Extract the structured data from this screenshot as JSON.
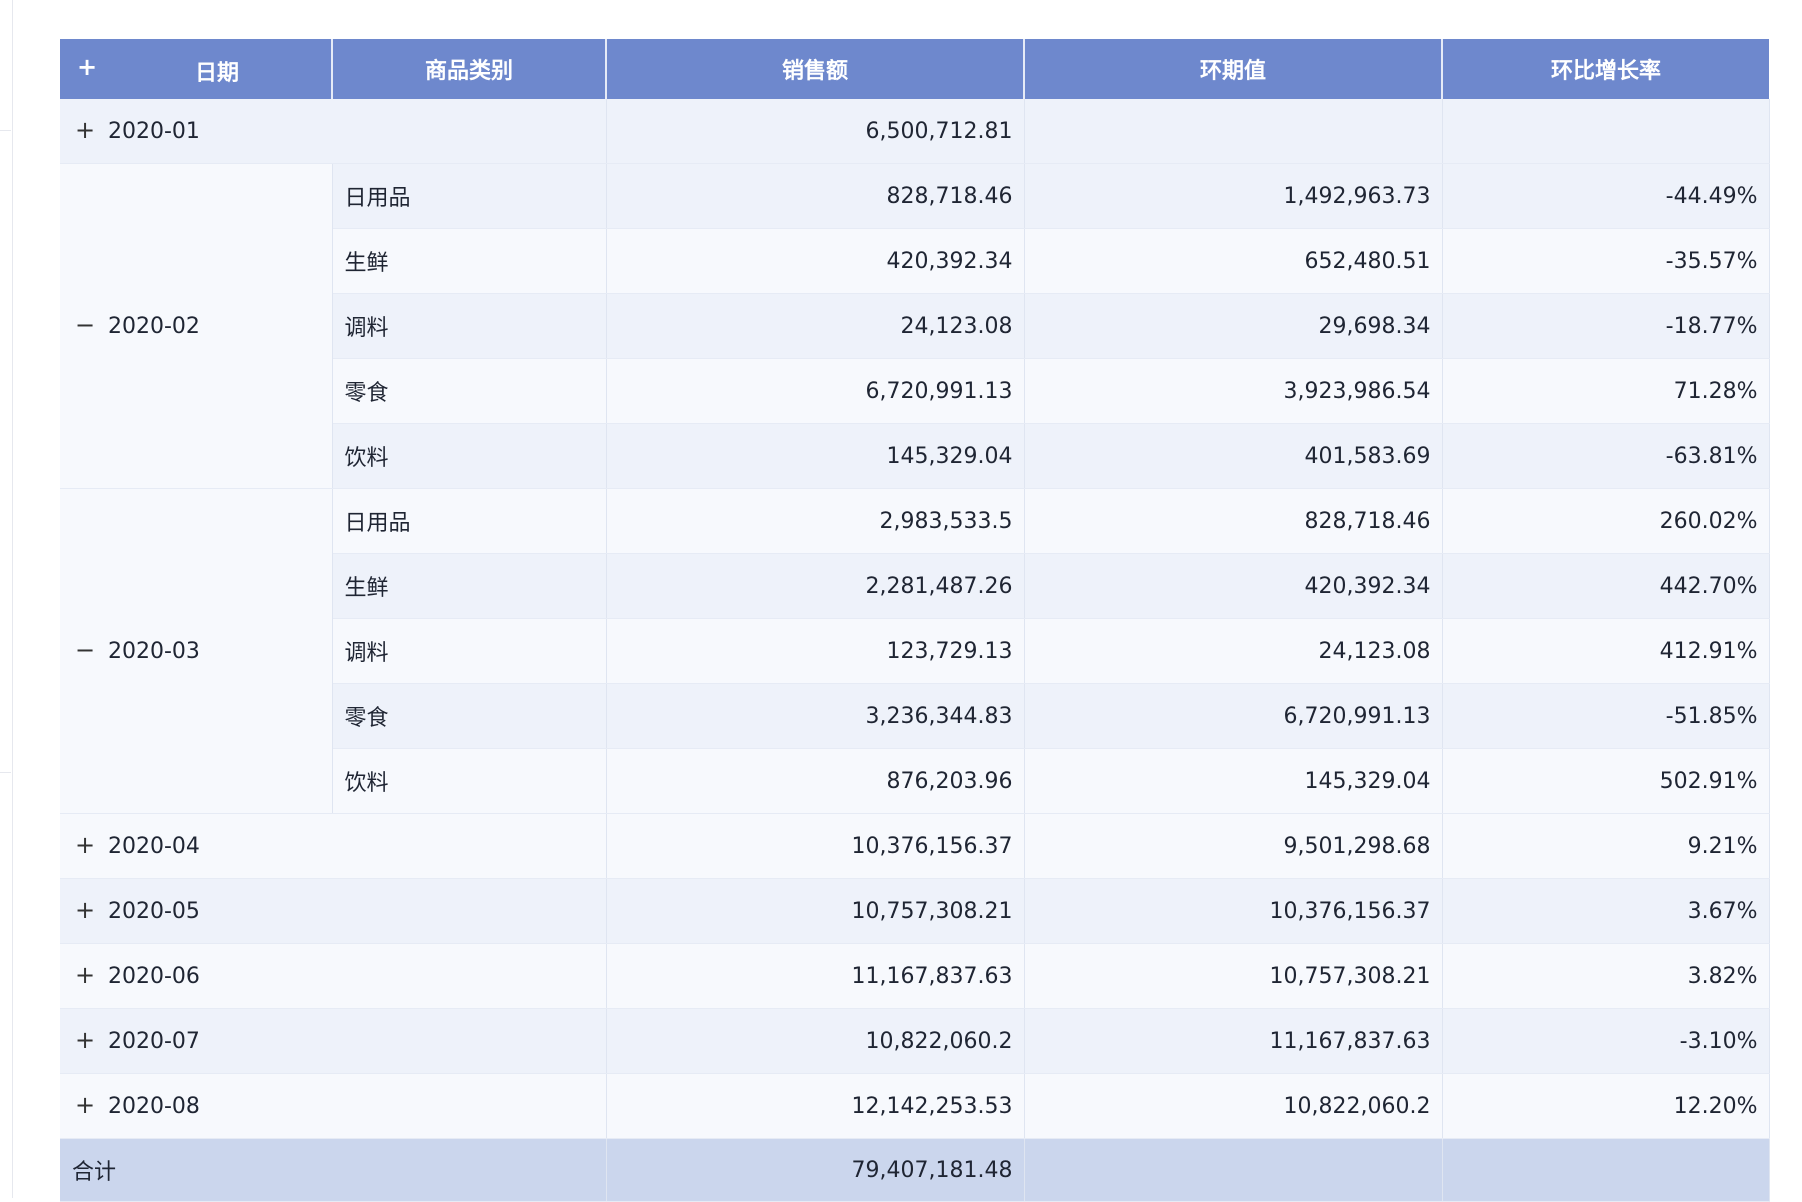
{
  "header": {
    "columns": [
      "日期",
      "商品类别",
      "销售额",
      "环期值",
      "环比增长率"
    ],
    "expand_all": "+"
  },
  "rows": [
    {
      "date": "2020-01",
      "toggle": "+",
      "sales": "6,500,712.81",
      "prev": "",
      "rate": ""
    },
    {
      "date": "2020-02",
      "toggle": "−",
      "children": [
        {
          "category": "日用品",
          "sales": "828,718.46",
          "prev": "1,492,963.73",
          "rate": "-44.49%"
        },
        {
          "category": "生鲜",
          "sales": "420,392.34",
          "prev": "652,480.51",
          "rate": "-35.57%"
        },
        {
          "category": "调料",
          "sales": "24,123.08",
          "prev": "29,698.34",
          "rate": "-18.77%"
        },
        {
          "category": "零食",
          "sales": "6,720,991.13",
          "prev": "3,923,986.54",
          "rate": "71.28%"
        },
        {
          "category": "饮料",
          "sales": "145,329.04",
          "prev": "401,583.69",
          "rate": "-63.81%"
        }
      ]
    },
    {
      "date": "2020-03",
      "toggle": "−",
      "children": [
        {
          "category": "日用品",
          "sales": "2,983,533.5",
          "prev": "828,718.46",
          "rate": "260.02%"
        },
        {
          "category": "生鲜",
          "sales": "2,281,487.26",
          "prev": "420,392.34",
          "rate": "442.70%"
        },
        {
          "category": "调料",
          "sales": "123,729.13",
          "prev": "24,123.08",
          "rate": "412.91%"
        },
        {
          "category": "零食",
          "sales": "3,236,344.83",
          "prev": "6,720,991.13",
          "rate": "-51.85%"
        },
        {
          "category": "饮料",
          "sales": "876,203.96",
          "prev": "145,329.04",
          "rate": "502.91%"
        }
      ]
    },
    {
      "date": "2020-04",
      "toggle": "+",
      "sales": "10,376,156.37",
      "prev": "9,501,298.68",
      "rate": "9.21%"
    },
    {
      "date": "2020-05",
      "toggle": "+",
      "sales": "10,757,308.21",
      "prev": "10,376,156.37",
      "rate": "3.67%"
    },
    {
      "date": "2020-06",
      "toggle": "+",
      "sales": "11,167,837.63",
      "prev": "10,757,308.21",
      "rate": "3.82%"
    },
    {
      "date": "2020-07",
      "toggle": "+",
      "sales": "10,822,060.2",
      "prev": "11,167,837.63",
      "rate": "-3.10%"
    },
    {
      "date": "2020-08",
      "toggle": "+",
      "sales": "12,142,253.53",
      "prev": "10,822,060.2",
      "rate": "12.20%"
    }
  ],
  "total": {
    "label": "合计",
    "sales": "79,407,181.48",
    "prev": "",
    "rate": ""
  }
}
